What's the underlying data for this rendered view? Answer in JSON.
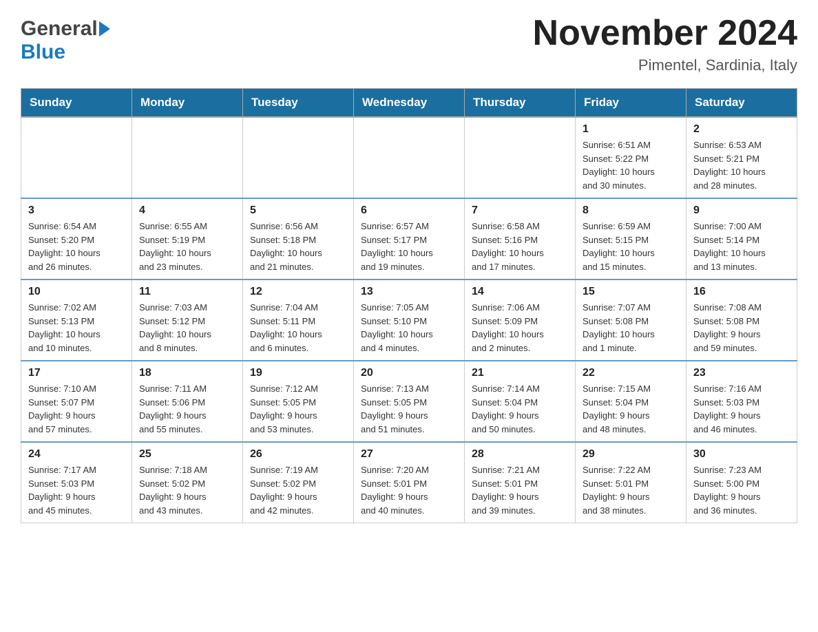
{
  "header": {
    "title": "November 2024",
    "subtitle": "Pimentel, Sardinia, Italy",
    "logo_general": "General",
    "logo_blue": "Blue"
  },
  "weekdays": [
    "Sunday",
    "Monday",
    "Tuesday",
    "Wednesday",
    "Thursday",
    "Friday",
    "Saturday"
  ],
  "weeks": [
    [
      {
        "day": "",
        "info": ""
      },
      {
        "day": "",
        "info": ""
      },
      {
        "day": "",
        "info": ""
      },
      {
        "day": "",
        "info": ""
      },
      {
        "day": "",
        "info": ""
      },
      {
        "day": "1",
        "info": "Sunrise: 6:51 AM\nSunset: 5:22 PM\nDaylight: 10 hours\nand 30 minutes."
      },
      {
        "day": "2",
        "info": "Sunrise: 6:53 AM\nSunset: 5:21 PM\nDaylight: 10 hours\nand 28 minutes."
      }
    ],
    [
      {
        "day": "3",
        "info": "Sunrise: 6:54 AM\nSunset: 5:20 PM\nDaylight: 10 hours\nand 26 minutes."
      },
      {
        "day": "4",
        "info": "Sunrise: 6:55 AM\nSunset: 5:19 PM\nDaylight: 10 hours\nand 23 minutes."
      },
      {
        "day": "5",
        "info": "Sunrise: 6:56 AM\nSunset: 5:18 PM\nDaylight: 10 hours\nand 21 minutes."
      },
      {
        "day": "6",
        "info": "Sunrise: 6:57 AM\nSunset: 5:17 PM\nDaylight: 10 hours\nand 19 minutes."
      },
      {
        "day": "7",
        "info": "Sunrise: 6:58 AM\nSunset: 5:16 PM\nDaylight: 10 hours\nand 17 minutes."
      },
      {
        "day": "8",
        "info": "Sunrise: 6:59 AM\nSunset: 5:15 PM\nDaylight: 10 hours\nand 15 minutes."
      },
      {
        "day": "9",
        "info": "Sunrise: 7:00 AM\nSunset: 5:14 PM\nDaylight: 10 hours\nand 13 minutes."
      }
    ],
    [
      {
        "day": "10",
        "info": "Sunrise: 7:02 AM\nSunset: 5:13 PM\nDaylight: 10 hours\nand 10 minutes."
      },
      {
        "day": "11",
        "info": "Sunrise: 7:03 AM\nSunset: 5:12 PM\nDaylight: 10 hours\nand 8 minutes."
      },
      {
        "day": "12",
        "info": "Sunrise: 7:04 AM\nSunset: 5:11 PM\nDaylight: 10 hours\nand 6 minutes."
      },
      {
        "day": "13",
        "info": "Sunrise: 7:05 AM\nSunset: 5:10 PM\nDaylight: 10 hours\nand 4 minutes."
      },
      {
        "day": "14",
        "info": "Sunrise: 7:06 AM\nSunset: 5:09 PM\nDaylight: 10 hours\nand 2 minutes."
      },
      {
        "day": "15",
        "info": "Sunrise: 7:07 AM\nSunset: 5:08 PM\nDaylight: 10 hours\nand 1 minute."
      },
      {
        "day": "16",
        "info": "Sunrise: 7:08 AM\nSunset: 5:08 PM\nDaylight: 9 hours\nand 59 minutes."
      }
    ],
    [
      {
        "day": "17",
        "info": "Sunrise: 7:10 AM\nSunset: 5:07 PM\nDaylight: 9 hours\nand 57 minutes."
      },
      {
        "day": "18",
        "info": "Sunrise: 7:11 AM\nSunset: 5:06 PM\nDaylight: 9 hours\nand 55 minutes."
      },
      {
        "day": "19",
        "info": "Sunrise: 7:12 AM\nSunset: 5:05 PM\nDaylight: 9 hours\nand 53 minutes."
      },
      {
        "day": "20",
        "info": "Sunrise: 7:13 AM\nSunset: 5:05 PM\nDaylight: 9 hours\nand 51 minutes."
      },
      {
        "day": "21",
        "info": "Sunrise: 7:14 AM\nSunset: 5:04 PM\nDaylight: 9 hours\nand 50 minutes."
      },
      {
        "day": "22",
        "info": "Sunrise: 7:15 AM\nSunset: 5:04 PM\nDaylight: 9 hours\nand 48 minutes."
      },
      {
        "day": "23",
        "info": "Sunrise: 7:16 AM\nSunset: 5:03 PM\nDaylight: 9 hours\nand 46 minutes."
      }
    ],
    [
      {
        "day": "24",
        "info": "Sunrise: 7:17 AM\nSunset: 5:03 PM\nDaylight: 9 hours\nand 45 minutes."
      },
      {
        "day": "25",
        "info": "Sunrise: 7:18 AM\nSunset: 5:02 PM\nDaylight: 9 hours\nand 43 minutes."
      },
      {
        "day": "26",
        "info": "Sunrise: 7:19 AM\nSunset: 5:02 PM\nDaylight: 9 hours\nand 42 minutes."
      },
      {
        "day": "27",
        "info": "Sunrise: 7:20 AM\nSunset: 5:01 PM\nDaylight: 9 hours\nand 40 minutes."
      },
      {
        "day": "28",
        "info": "Sunrise: 7:21 AM\nSunset: 5:01 PM\nDaylight: 9 hours\nand 39 minutes."
      },
      {
        "day": "29",
        "info": "Sunrise: 7:22 AM\nSunset: 5:01 PM\nDaylight: 9 hours\nand 38 minutes."
      },
      {
        "day": "30",
        "info": "Sunrise: 7:23 AM\nSunset: 5:00 PM\nDaylight: 9 hours\nand 36 minutes."
      }
    ]
  ]
}
